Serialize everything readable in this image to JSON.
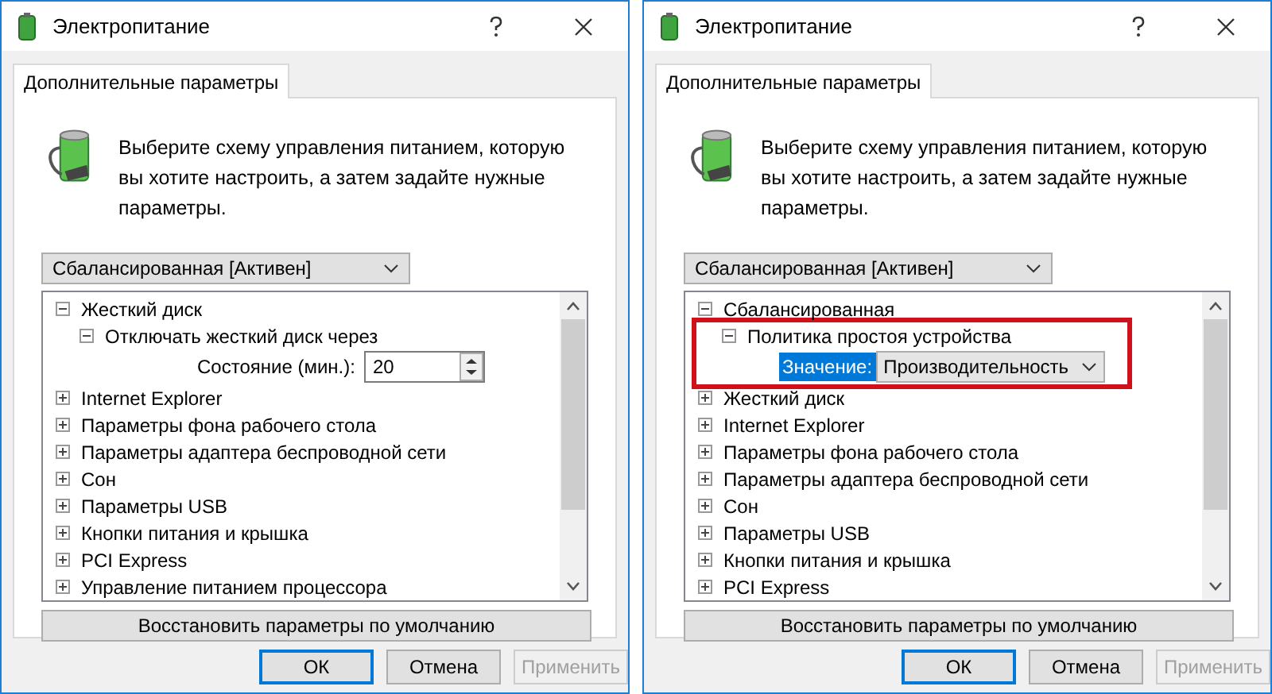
{
  "windows": [
    {
      "title": "Электропитание",
      "tab": {
        "label": "Дополнительные параметры",
        "selected": true
      },
      "description": "Выберите схему управления питанием, которую вы хотите настроить, а затем задайте нужные параметры.",
      "scheme_select": {
        "value": "Сбалансированная [Активен]"
      },
      "tree": [
        {
          "label": "Жесткий диск",
          "expanded": true,
          "children": [
            {
              "label": "Отключать жесткий диск через",
              "expanded": true,
              "highlighted": false,
              "setting": {
                "kind": "spin",
                "label": "Состояние (мин.):",
                "value": "20",
                "label_selected": false
              }
            }
          ]
        },
        {
          "label": "Internet Explorer",
          "expanded": false
        },
        {
          "label": "Параметры фона рабочего стола",
          "expanded": false
        },
        {
          "label": "Параметры адаптера беспроводной сети",
          "expanded": false
        },
        {
          "label": "Сон",
          "expanded": false
        },
        {
          "label": "Параметры USB",
          "expanded": false
        },
        {
          "label": "Кнопки питания и крышка",
          "expanded": false
        },
        {
          "label": "PCI Express",
          "expanded": false
        },
        {
          "label": "Управление питанием процессора",
          "expanded": false
        }
      ],
      "restore_button": "Восстановить параметры по умолчанию",
      "buttons": [
        {
          "label": "ОК",
          "kind": "default",
          "disabled": false
        },
        {
          "label": "Отмена",
          "kind": "normal",
          "disabled": false
        },
        {
          "label": "Применить",
          "kind": "normal",
          "disabled": true
        }
      ]
    },
    {
      "title": "Электропитание",
      "tab": {
        "label": "Дополнительные параметры",
        "selected": true
      },
      "description": "Выберите схему управления питанием, которую вы хотите настроить, а затем задайте нужные параметры.",
      "scheme_select": {
        "value": "Сбалансированная [Активен]"
      },
      "tree": [
        {
          "label": "Сбалансированная",
          "expanded": true,
          "children": [
            {
              "label": "Политика простоя устройства",
              "expanded": true,
              "highlighted": true,
              "setting": {
                "kind": "select",
                "label": "Значение:",
                "value": "Производительность",
                "label_selected": true
              }
            }
          ]
        },
        {
          "label": "Жесткий диск",
          "expanded": false
        },
        {
          "label": "Internet Explorer",
          "expanded": false
        },
        {
          "label": "Параметры фона рабочего стола",
          "expanded": false
        },
        {
          "label": "Параметры адаптера беспроводной сети",
          "expanded": false
        },
        {
          "label": "Сон",
          "expanded": false
        },
        {
          "label": "Параметры USB",
          "expanded": false
        },
        {
          "label": "Кнопки питания и крышка",
          "expanded": false
        },
        {
          "label": "PCI Express",
          "expanded": false
        }
      ],
      "restore_button": "Восстановить параметры по умолчанию",
      "buttons": [
        {
          "label": "ОК",
          "kind": "default",
          "disabled": false
        },
        {
          "label": "Отмена",
          "kind": "normal",
          "disabled": false
        },
        {
          "label": "Применить",
          "kind": "normal",
          "disabled": true
        }
      ]
    }
  ]
}
